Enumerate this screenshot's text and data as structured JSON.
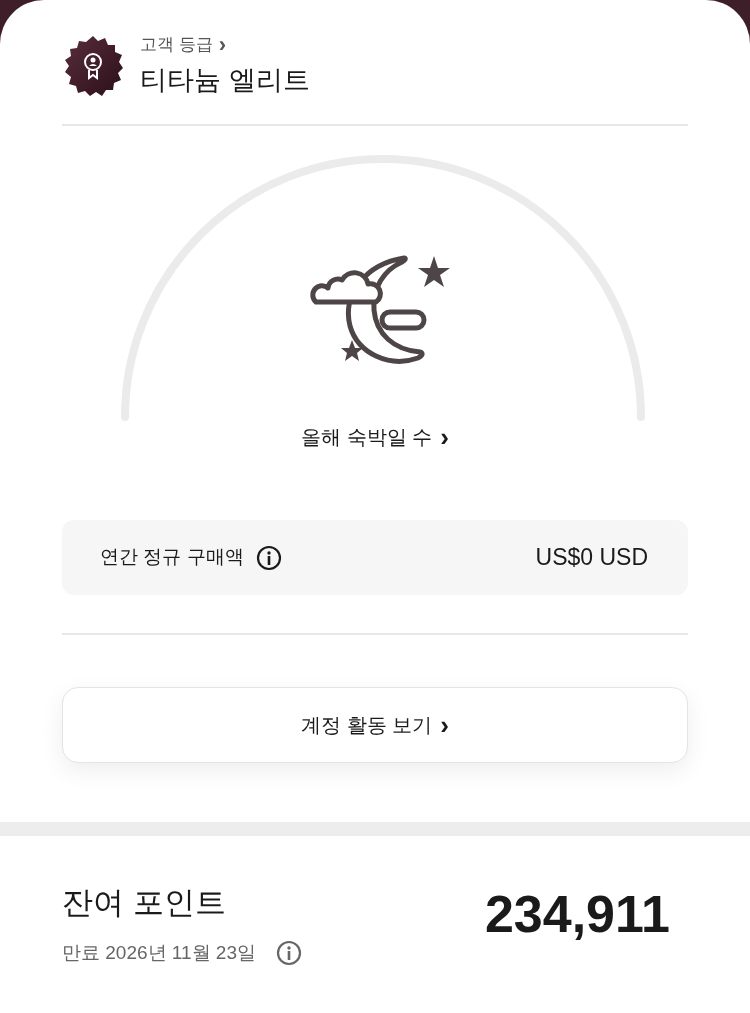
{
  "tier": {
    "label": "고객 등급",
    "chevron": "›",
    "name": "티타늄 엘리트"
  },
  "nights": {
    "label": "올해 숙박일 수",
    "chevron": "›"
  },
  "purchase": {
    "label": "연간 정규 구매액",
    "value": "US$0 USD"
  },
  "activity_button": {
    "label": "계정 활동 보기",
    "chevron": "›"
  },
  "points": {
    "label": "잔여 포인트",
    "expiry": "만료 2026년 11월 23일",
    "value": "234,911"
  }
}
